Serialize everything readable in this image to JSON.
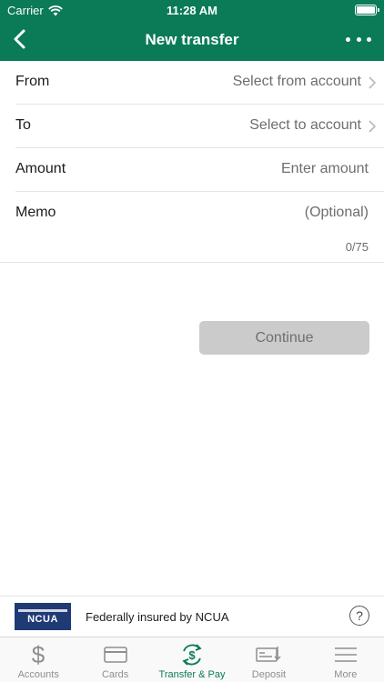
{
  "status_bar": {
    "carrier": "Carrier",
    "time": "11:28 AM"
  },
  "nav": {
    "title": "New transfer"
  },
  "form": {
    "from": {
      "label": "From",
      "value": "Select from account"
    },
    "to": {
      "label": "To",
      "value": "Select to account"
    },
    "amount": {
      "label": "Amount",
      "placeholder": "Enter amount"
    },
    "memo": {
      "label": "Memo",
      "placeholder": "(Optional)",
      "counter": "0/75"
    }
  },
  "continue_label": "Continue",
  "ncua": {
    "logo_text": "NCUA",
    "text": "Federally insured by NCUA",
    "help": "?"
  },
  "tabs": [
    {
      "label": "Accounts",
      "icon": "dollar-icon",
      "active": false
    },
    {
      "label": "Cards",
      "icon": "card-icon",
      "active": false
    },
    {
      "label": "Transfer & Pay",
      "icon": "transfer-pay-icon",
      "active": true
    },
    {
      "label": "Deposit",
      "icon": "check-deposit-icon",
      "active": false
    },
    {
      "label": "More",
      "icon": "menu-icon",
      "active": false
    }
  ],
  "colors": {
    "brand": "#0b7a57",
    "inactive": "#8e8e93",
    "button_disabled": "#cbcbcb"
  }
}
